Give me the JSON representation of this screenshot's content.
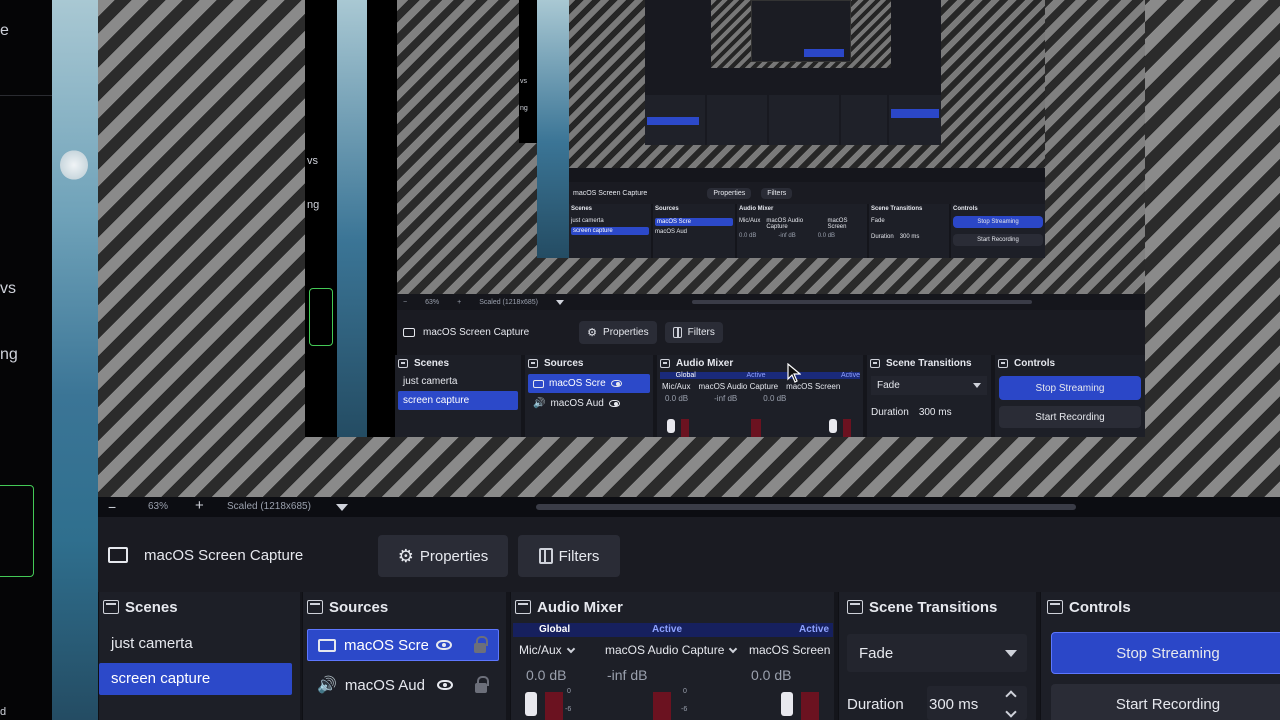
{
  "left_strip": {
    "fragments": [
      "e",
      "vs",
      "ng",
      "vs",
      "ng",
      "d"
    ]
  },
  "main": {
    "zoom": {
      "minus": "−",
      "percent": "63%",
      "plus": "+",
      "scale_label": "Scaled (1218x685)"
    },
    "context": {
      "source_name": "macOS Screen Capture",
      "properties_label": "Properties",
      "filters_label": "Filters"
    },
    "scenes": {
      "title": "Scenes",
      "items": [
        "just camerta",
        "screen capture"
      ],
      "selected_index": 1
    },
    "sources": {
      "title": "Sources",
      "items": [
        {
          "name": "macOS Scre",
          "icon": "monitor-icon",
          "selected": true
        },
        {
          "name": "macOS Aud",
          "icon": "speaker-icon",
          "selected": false
        }
      ]
    },
    "audio_mixer": {
      "title": "Audio Mixer",
      "channels": [
        {
          "tag": "Global",
          "name": "Mic/Aux",
          "level": "0.0 dB"
        },
        {
          "tag": "Active",
          "name": "macOS Audio Capture",
          "level": "-inf dB"
        },
        {
          "tag": "Active",
          "name": "macOS Screen",
          "level": "0.0 dB"
        }
      ],
      "ticks": [
        "0",
        "-6"
      ]
    },
    "transitions": {
      "title": "Scene Transitions",
      "value": "Fade",
      "duration_label": "Duration",
      "duration_value": "300 ms"
    },
    "controls": {
      "title": "Controls",
      "stop_streaming": "Stop Streaming",
      "start_recording": "Start Recording"
    }
  },
  "nest2": {
    "zoom": {
      "percent": "63%",
      "scale_label": "Scaled (1218x685)"
    },
    "context": {
      "source_name": "macOS Screen Capture",
      "properties_label": "Properties",
      "filters_label": "Filters"
    },
    "scenes": {
      "title": "Scenes",
      "items": [
        "just camerta",
        "screen capture"
      ]
    },
    "sources": {
      "title": "Sources",
      "items": [
        "macOS Scre",
        "macOS Aud"
      ]
    },
    "audio_mixer": {
      "title": "Audio Mixer",
      "tags": [
        "Global",
        "Active",
        "Active"
      ],
      "names": [
        "Mic/Aux",
        "macOS Audio Capture",
        "macOS Screen"
      ],
      "levels": [
        "0.0 dB",
        "-inf dB",
        "0.0 dB"
      ]
    },
    "transitions": {
      "title": "Scene Transitions",
      "value": "Fade",
      "duration_label": "Duration",
      "duration_value": "300 ms"
    },
    "controls": {
      "title": "Controls",
      "stop_streaming": "Stop Streaming",
      "start_recording": "Start Recording"
    }
  },
  "nest3": {
    "context": {
      "source_name": "macOS Screen Capture",
      "properties_label": "Properties",
      "filters_label": "Filters"
    },
    "scenes": {
      "title": "Scenes",
      "items": [
        "just camerta",
        "screen capture"
      ]
    },
    "sources": {
      "title": "Sources",
      "items": [
        "macOS Scre",
        "macOS Aud"
      ]
    },
    "audio_mixer": {
      "title": "Audio Mixer",
      "names": [
        "Mic/Aux",
        "macOS Audio Capture",
        "macOS Screen"
      ],
      "levels": [
        "0.0 dB",
        "-inf dB",
        "0.0 dB"
      ]
    },
    "transitions": {
      "title": "Scene Transitions",
      "value": "Fade",
      "duration_label": "Duration",
      "duration_value": "300 ms"
    },
    "controls": {
      "title": "Controls",
      "stop_streaming": "Stop Streaming",
      "start_recording": "Start Recording"
    }
  },
  "colors": {
    "accent_blue": "#2b47c8",
    "selection_blue": "#2c49c9",
    "meter_red": "#6b1220",
    "green_outline": "#44c956"
  }
}
